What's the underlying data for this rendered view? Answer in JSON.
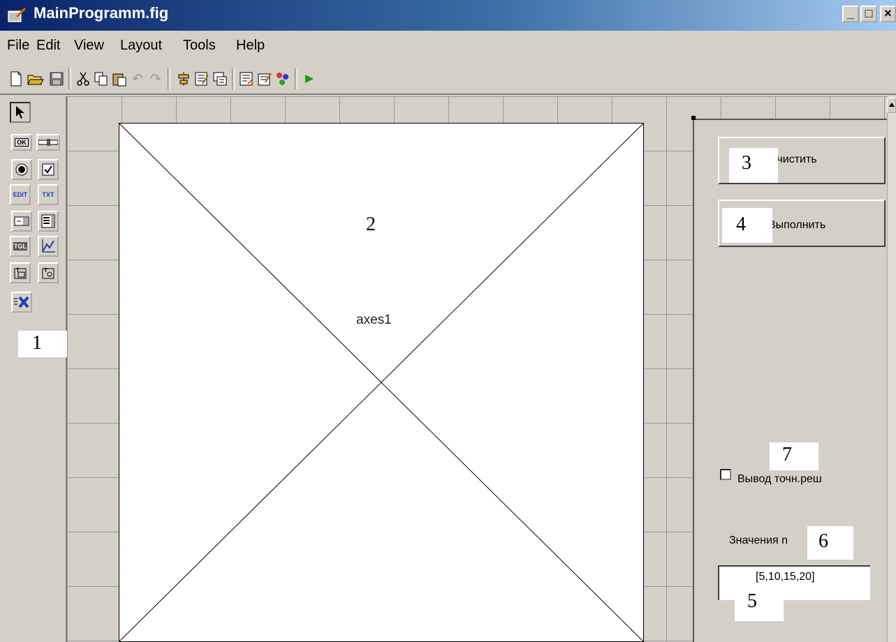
{
  "window": {
    "title": "MainProgramm.fig",
    "controls": {
      "minimize": "_",
      "maximize": "□",
      "close": "×"
    }
  },
  "menu": [
    {
      "label": "File"
    },
    {
      "label": "Edit"
    },
    {
      "label": "View"
    },
    {
      "label": "Layout"
    },
    {
      "label": "Tools"
    },
    {
      "label": "Help"
    }
  ],
  "toolbar": {
    "icons": [
      "new-file-icon",
      "open-folder-icon",
      "save-icon",
      "cut-icon",
      "copy-icon",
      "paste-icon",
      "undo-icon",
      "redo-icon",
      "align-icon",
      "property-inspector-icon",
      "tab-order-icon",
      "mfile-editor-icon",
      "menu-editor-icon",
      "object-browser-icon",
      "run-icon"
    ]
  },
  "palette": {
    "tools": [
      "select-arrow",
      "push-button",
      "slider",
      "radio-button",
      "checkbox",
      "edit-text",
      "static-text",
      "popup-menu",
      "listbox",
      "toggle-button",
      "axes",
      "panel",
      "button-group",
      "activex-control"
    ],
    "labels": {
      "push": "OK",
      "edit": "EDIT",
      "text": "TXT",
      "toggle": "TGL"
    },
    "callout": "1"
  },
  "canvas": {
    "axes_label": "axes1",
    "axes_callout": "2",
    "clear_button": {
      "label": "Очистить",
      "callout": "3"
    },
    "run_button": {
      "label": "Выполнить",
      "callout": "4"
    },
    "checkbox": {
      "label": "Вывод точн.реш",
      "checked": false,
      "callout": "7"
    },
    "n_label": {
      "text": "Значения n",
      "callout": "6"
    },
    "n_edit": {
      "value": "[5,10,15,20]",
      "callout": "5"
    }
  }
}
